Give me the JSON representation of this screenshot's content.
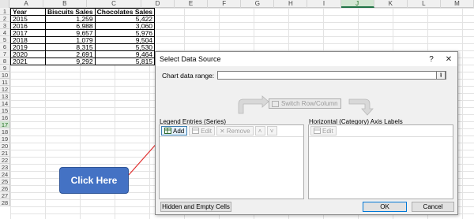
{
  "sheet": {
    "columns": [
      "A",
      "B",
      "C",
      "D",
      "E",
      "F",
      "G",
      "H",
      "I",
      "J",
      "K",
      "L",
      "M"
    ],
    "active_column": "J",
    "rows": [
      "1",
      "2",
      "3",
      "4",
      "5",
      "6",
      "7",
      "8",
      "9",
      "10",
      "11",
      "12",
      "13",
      "14",
      "15",
      "16",
      "17",
      "18",
      "19",
      "20",
      "21",
      "22",
      "23",
      "24",
      "25",
      "26",
      "27",
      "28"
    ],
    "active_row": "17",
    "table_headers": [
      "Year",
      "Biscuits Sales",
      "Chocolates Sales"
    ],
    "table_rows": [
      [
        "2015",
        "1,259",
        "5,422"
      ],
      [
        "2016",
        "6,988",
        "3,060"
      ],
      [
        "2017",
        "9,657",
        "5,976"
      ],
      [
        "2018",
        "1,079",
        "9,504"
      ],
      [
        "2019",
        "8,315",
        "5,530"
      ],
      [
        "2020",
        "2,691",
        "9,464"
      ],
      [
        "2021",
        "9,292",
        "5,815"
      ]
    ]
  },
  "callout": {
    "text": "Click Here",
    "color": "#4472c4",
    "arrow_color": "#e03030"
  },
  "dialog": {
    "title": "Select Data Source",
    "help": "?",
    "close": "✕",
    "range_label": "Chart data range:",
    "range_value": "",
    "switch_label": "Switch Row/Column",
    "legend_label": "Legend Entries (Series)",
    "legend_buttons": {
      "add": "Add",
      "edit": "Edit",
      "remove": "Remove"
    },
    "axis_label": "Horizontal (Category) Axis Labels",
    "axis_edit": "Edit",
    "hidden_cells": "Hidden and Empty Cells",
    "ok": "OK",
    "cancel": "Cancel"
  }
}
